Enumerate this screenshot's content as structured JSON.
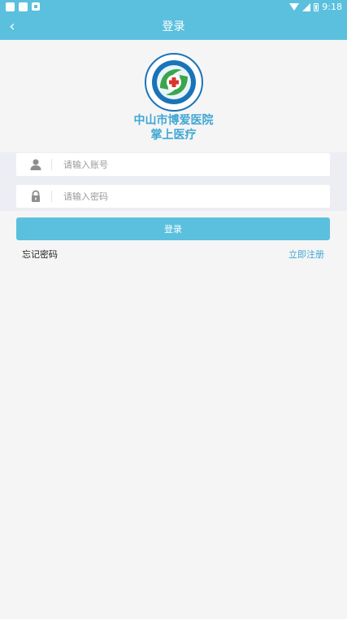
{
  "status_bar": {
    "time": "9:18",
    "icons": [
      "notification-square-icon",
      "notification-square-icon",
      "notification-small-icon",
      "wifi-icon",
      "signal-icon",
      "battery-icon"
    ]
  },
  "nav": {
    "back_icon": "chevron-left-icon",
    "back_glyph": "‹",
    "title": "登录"
  },
  "header": {
    "logo_icon": "hospital-logo-icon",
    "hospital_name": "中山市博爱医院",
    "subtitle": "掌上医疗"
  },
  "form": {
    "username": {
      "icon": "user-icon",
      "value": "",
      "placeholder": "请输入账号"
    },
    "password": {
      "icon": "lock-icon",
      "value": "",
      "placeholder": "请输入密码"
    }
  },
  "actions": {
    "login_label": "登录",
    "forgot_label": "忘记密码",
    "register_label": "立即注册"
  },
  "colors": {
    "primary": "#5bc0de",
    "accent_text": "#3fa7d4",
    "background": "#f5f5f5",
    "logo_green": "#3aa64a",
    "logo_blue": "#1a74b8"
  }
}
